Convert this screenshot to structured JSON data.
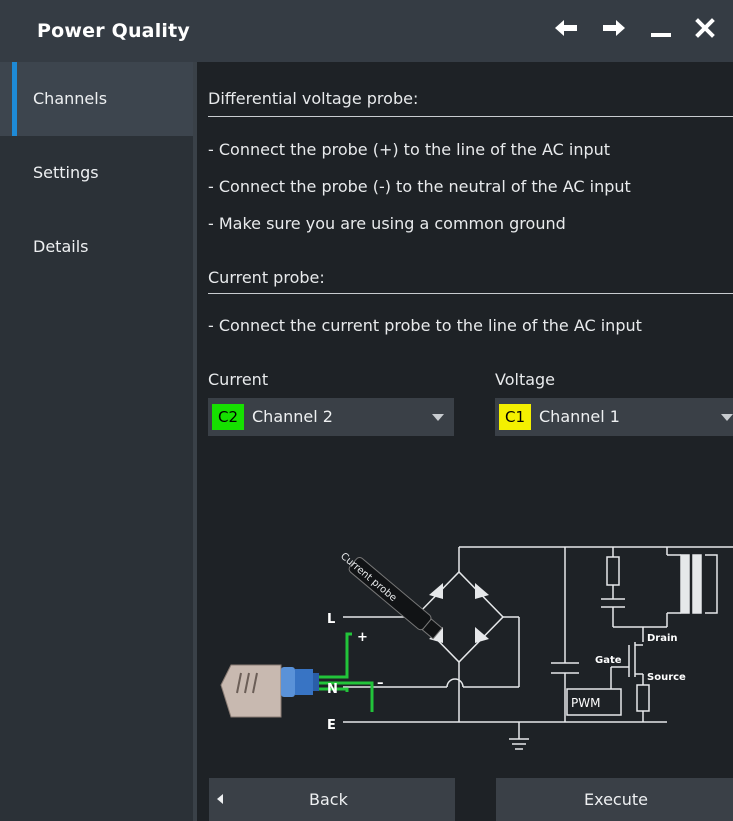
{
  "window": {
    "title": "Power Quality"
  },
  "titlebar_icons": [
    "back-arrow-icon",
    "forward-arrow-icon",
    "minimize-icon",
    "close-icon"
  ],
  "sidebar": {
    "items": [
      {
        "label": "Channels",
        "active": true
      },
      {
        "label": "Settings",
        "active": false
      },
      {
        "label": "Details",
        "active": false
      }
    ]
  },
  "content": {
    "voltage_section_heading": "Differential voltage probe:",
    "voltage_instructions": [
      "- Connect the probe (+) to the line of the AC input",
      "- Connect the probe (-) to the neutral of the AC input",
      "- Make sure you are using a common ground"
    ],
    "current_section_heading": "Current probe:",
    "current_instructions": [
      "- Connect the current probe to the line of the AC input"
    ],
    "current_select": {
      "label": "Current",
      "badge": "C2",
      "value": "Channel 2",
      "badge_color": "#16e000"
    },
    "voltage_select": {
      "label": "Voltage",
      "badge": "C1",
      "value": "Channel 1",
      "badge_color": "#f4f000"
    }
  },
  "diagram": {
    "current_probe_label": "Current probe",
    "terminal_L": "L",
    "terminal_N": "N",
    "terminal_E": "E",
    "plus_sign": "+",
    "minus_sign": "–",
    "gate_label": "Gate",
    "drain_label": "Drain",
    "source_label": "Source",
    "pwm_label": "PWM"
  },
  "buttons": {
    "back": "Back",
    "execute": "Execute"
  },
  "colors": {
    "accent": "#1e8ad6",
    "probe_wire": "#22c43a",
    "titlebar": "#353c44"
  }
}
